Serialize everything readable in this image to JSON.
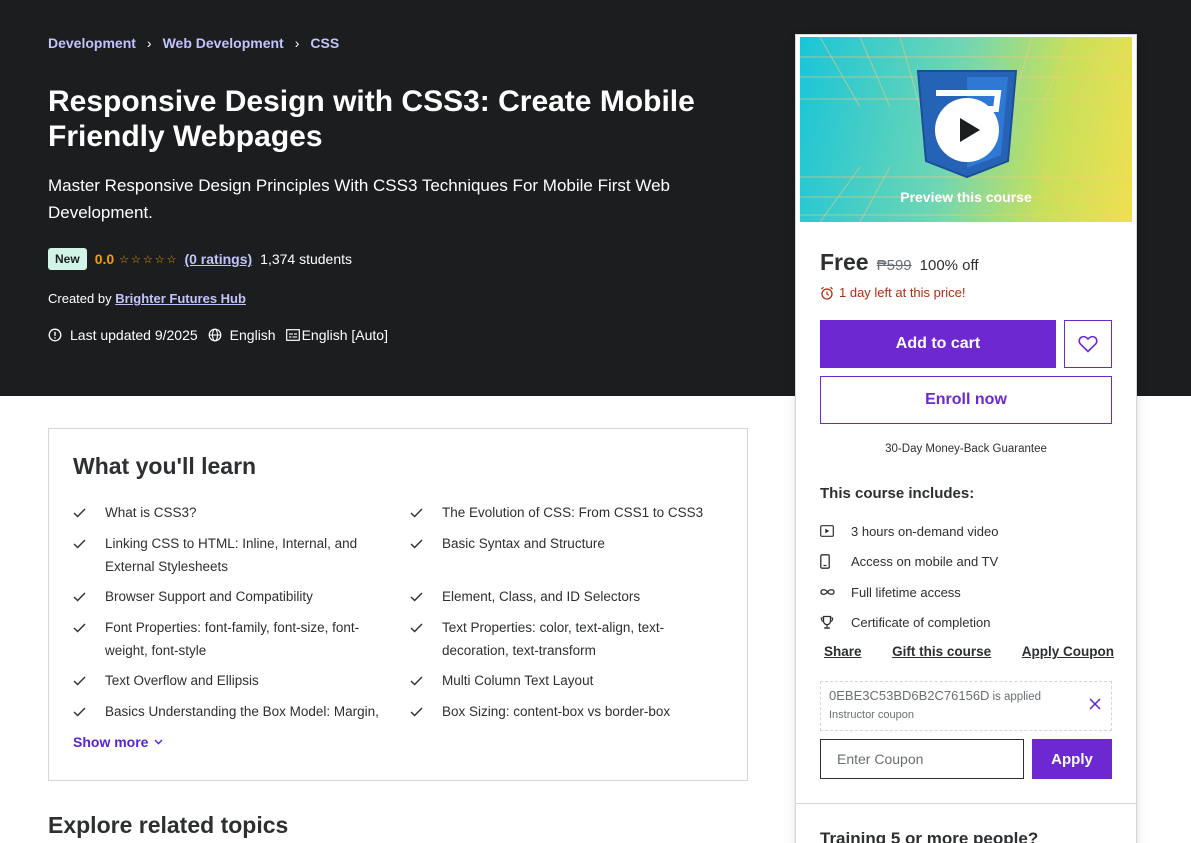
{
  "breadcrumb": [
    "Development",
    "Web Development",
    "CSS"
  ],
  "course": {
    "title": "Responsive Design with CSS3: Create Mobile Friendly Webpages",
    "subtitle": "Master Responsive Design Principles With CSS3 Techniques For Mobile First Web Development.",
    "badge": "New",
    "rating": "0.0",
    "rating_stars": 0,
    "ratings_link": "(0 ratings)",
    "students": "1,374 students",
    "created_by_label": "Created by",
    "instructor": "Brighter Futures Hub",
    "last_updated": "Last updated 9/2025",
    "language": "English",
    "captions": "English [Auto]"
  },
  "learn": {
    "title": "What you'll learn",
    "items": [
      "What is CSS3?",
      "The Evolution of CSS: From CSS1 to CSS3",
      "Linking CSS to HTML: Inline, Internal, and External Stylesheets",
      "Basic Syntax and Structure",
      "Browser Support and Compatibility",
      "Element, Class, and ID Selectors",
      "Font Properties: font-family, font-size, font-weight, font-style",
      "Text Properties: color, text-align, text-decoration, text-transform",
      "Text Overflow and Ellipsis",
      "Multi Column Text Layout",
      "Basics Understanding the Box Model: Margin,",
      "Box Sizing: content-box vs border-box"
    ],
    "show_more": "Show more"
  },
  "explore_title": "Explore related topics",
  "sidebar": {
    "preview_label": "Preview this course",
    "price": "Free",
    "original_price": "₱599",
    "discount": "100% off",
    "deadline": "1 day left at this price!",
    "add_to_cart": "Add to cart",
    "enroll": "Enroll now",
    "guarantee": "30-Day Money-Back Guarantee",
    "includes_title": "This course includes:",
    "includes": [
      {
        "icon": "video-icon",
        "text": "3 hours on-demand video"
      },
      {
        "icon": "mobile-icon",
        "text": "Access on mobile and TV"
      },
      {
        "icon": "infinity-icon",
        "text": "Full lifetime access"
      },
      {
        "icon": "trophy-icon",
        "text": "Certificate of completion"
      }
    ],
    "share": "Share",
    "gift": "Gift this course",
    "apply_coupon_link": "Apply Coupon",
    "coupon_code": "0EBE3C53BD6B2C76156D",
    "coupon_applied": "is applied",
    "coupon_type": "Instructor coupon",
    "coupon_placeholder": "Enter Coupon",
    "apply_button": "Apply",
    "training": "Training 5 or more people?"
  },
  "colors": {
    "header_bg": "#1c1d1f",
    "accent": "#6d28d2",
    "link_light": "#c0c4fc",
    "star": "#f69c08",
    "warning": "#b32d0f",
    "badge_bg": "#d2f4e6"
  }
}
